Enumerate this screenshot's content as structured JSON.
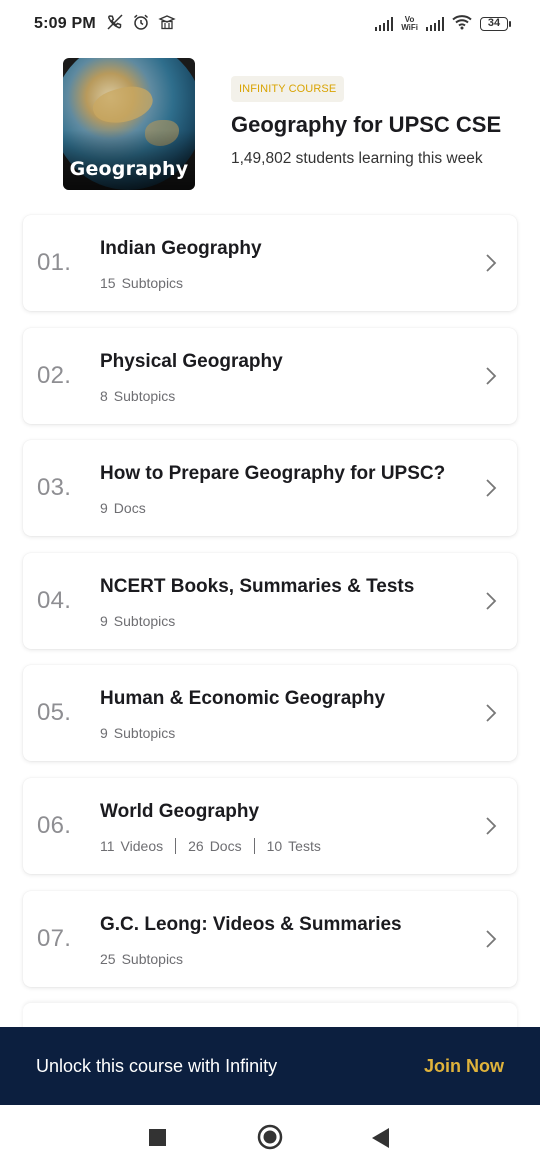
{
  "status_bar": {
    "time": "5:09 PM",
    "left_icons": [
      "no-call-icon",
      "alarm-icon",
      "school-icon"
    ],
    "network_label_top": "Vo",
    "network_label_bottom": "WiFi",
    "battery": "34"
  },
  "course": {
    "thumbnail_label": "Geography",
    "badge": "INFINITY COURSE",
    "title": "Geography for UPSC CSE",
    "subtitle": "1,49,802 students learning this week"
  },
  "topics": [
    {
      "num": "01.",
      "title": "Indian Geography",
      "meta": [
        {
          "count": "15",
          "unit": "Subtopics"
        }
      ]
    },
    {
      "num": "02.",
      "title": "Physical Geography",
      "meta": [
        {
          "count": "8",
          "unit": "Subtopics"
        }
      ]
    },
    {
      "num": "03.",
      "title": "How to Prepare Geography for UPSC?",
      "meta": [
        {
          "count": "9",
          "unit": "Docs"
        }
      ]
    },
    {
      "num": "04.",
      "title": "NCERT Books, Summaries & Tests",
      "meta": [
        {
          "count": "9",
          "unit": "Subtopics"
        }
      ]
    },
    {
      "num": "05.",
      "title": "Human & Economic Geography",
      "meta": [
        {
          "count": "9",
          "unit": "Subtopics"
        }
      ]
    },
    {
      "num": "06.",
      "title": "World Geography",
      "meta": [
        {
          "count": "11",
          "unit": "Videos"
        },
        {
          "count": "26",
          "unit": "Docs"
        },
        {
          "count": "10",
          "unit": "Tests"
        }
      ]
    },
    {
      "num": "07.",
      "title": "G.C. Leong: Videos & Summaries",
      "meta": [
        {
          "count": "25",
          "unit": "Subtopics"
        }
      ]
    }
  ],
  "cta": {
    "text": "Unlock this course with Infinity",
    "button": "Join Now"
  },
  "colors": {
    "cta_background": "#0c1f3f",
    "cta_accent": "#e0b33b",
    "badge_text": "#d9a404",
    "badge_background": "#f3f1ea"
  },
  "nav": {
    "icons": [
      "square-recents-icon",
      "circle-home-icon",
      "triangle-back-icon"
    ]
  }
}
